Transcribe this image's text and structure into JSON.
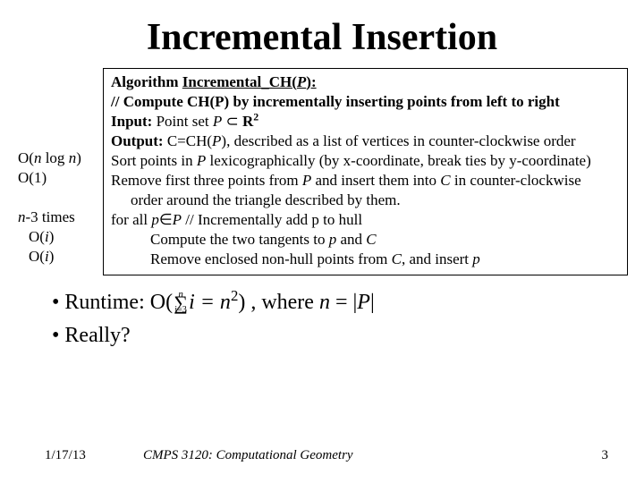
{
  "title": "Incremental Insertion",
  "complexity": {
    "l1": "O(n log n)",
    "l2": "O(1)",
    "l3": "n-3 times",
    "l4": "O(i)",
    "l5": "O(i)"
  },
  "algo": {
    "head_a": "Algorithm",
    "head_b": "Incremental_CH(",
    "head_c": "P",
    "head_d": "):",
    "comment": "// Compute CH(P) by incrementally inserting points from left to right",
    "input_a": "Input:",
    "input_b": " Point set ",
    "input_c": "P",
    "input_d": " ⊂ ",
    "input_e": "R",
    "input_f": "2",
    "output_a": "Output:",
    "output_b": " C=CH(",
    "output_c": "P",
    "output_d": "), described as a list of vertices in counter-clockwise order",
    "sort_a": "Sort points in ",
    "sort_b": "P",
    "sort_c": " lexicographically (by x-coordinate, break ties by y-coordinate)",
    "remove_a": "Remove first three points from ",
    "remove_b": "P",
    "remove_c": " and insert them into ",
    "remove_d": "C",
    "remove_e": " in counter-clockwise",
    "remove2": "order around the triangle described by them.",
    "for_a": "for all ",
    "for_b": "p",
    "for_c": "∈",
    "for_d": "P",
    "for_e": "   // Incrementally add p to hull",
    "tan_a": "Compute the two tangents to ",
    "tan_b": "p",
    "tan_c": " and ",
    "tan_d": "C",
    "enc_a": "Remove enclosed non-hull points from ",
    "enc_b": "C",
    "enc_c": ", and insert ",
    "enc_d": "p"
  },
  "bullets": {
    "runtime_a": "Runtime: O(",
    "sum_top": "n",
    "sum_sig": "∑",
    "sum_bot": "i=3",
    "runtime_b": "i = n",
    "runtime_sup": "2",
    "runtime_c": ") , where ",
    "runtime_d": "n",
    "runtime_e": " = |",
    "runtime_f": "P",
    "runtime_g": "|",
    "really": "Really?"
  },
  "footer": {
    "date": "1/17/13",
    "course": "CMPS 3120: Computational Geometry",
    "page": "3"
  }
}
